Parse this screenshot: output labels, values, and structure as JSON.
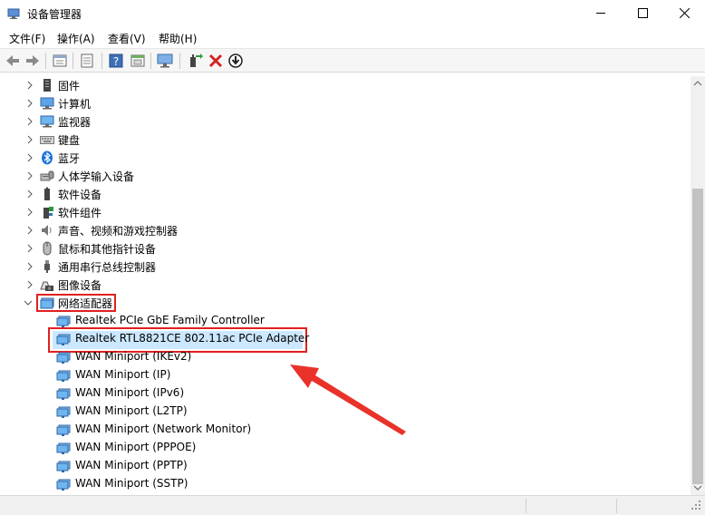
{
  "window": {
    "title": "设备管理器"
  },
  "menu": [
    {
      "label": "文件(F)"
    },
    {
      "label": "操作(A)"
    },
    {
      "label": "查看(V)"
    },
    {
      "label": "帮助(H)"
    }
  ],
  "toolbar": {
    "icons": [
      "back-icon",
      "forward-icon",
      "view-icon",
      "properties-icon",
      "help-icon",
      "view2-icon",
      "monitor-icon",
      "update-driver-icon",
      "uninstall-icon",
      "download-icon"
    ]
  },
  "tree": {
    "categories": [
      {
        "label": "固件",
        "icon": "firmware-icon"
      },
      {
        "label": "计算机",
        "icon": "computer-icon"
      },
      {
        "label": "监视器",
        "icon": "monitor-icon"
      },
      {
        "label": "键盘",
        "icon": "keyboard-icon"
      },
      {
        "label": "蓝牙",
        "icon": "bluetooth-icon"
      },
      {
        "label": "人体学输入设备",
        "icon": "hid-icon"
      },
      {
        "label": "软件设备",
        "icon": "software-device-icon"
      },
      {
        "label": "软件组件",
        "icon": "software-component-icon"
      },
      {
        "label": "声音、视频和游戏控制器",
        "icon": "sound-icon"
      },
      {
        "label": "鼠标和其他指针设备",
        "icon": "mouse-icon"
      },
      {
        "label": "通用串行总线控制器",
        "icon": "usb-icon"
      },
      {
        "label": "图像设备",
        "icon": "camera-icon"
      },
      {
        "label": "网络适配器",
        "icon": "network-icon",
        "expanded": true
      }
    ],
    "network_adapters": [
      {
        "label": "Realtek PCIe GbE Family Controller"
      },
      {
        "label": "Realtek RTL8821CE 802.11ac PCIe Adapter",
        "selected": true
      },
      {
        "label": "WAN Miniport (IKEv2)"
      },
      {
        "label": "WAN Miniport (IP)"
      },
      {
        "label": "WAN Miniport (IPv6)"
      },
      {
        "label": "WAN Miniport (L2TP)"
      },
      {
        "label": "WAN Miniport (Network Monitor)"
      },
      {
        "label": "WAN Miniport (PPPOE)"
      },
      {
        "label": "WAN Miniport (PPTP)"
      },
      {
        "label": "WAN Miniport (SSTP)"
      }
    ]
  },
  "colors": {
    "highlight_border": "#e02020",
    "selection_bg": "#cce8ff",
    "arrow": "#e8322a"
  }
}
